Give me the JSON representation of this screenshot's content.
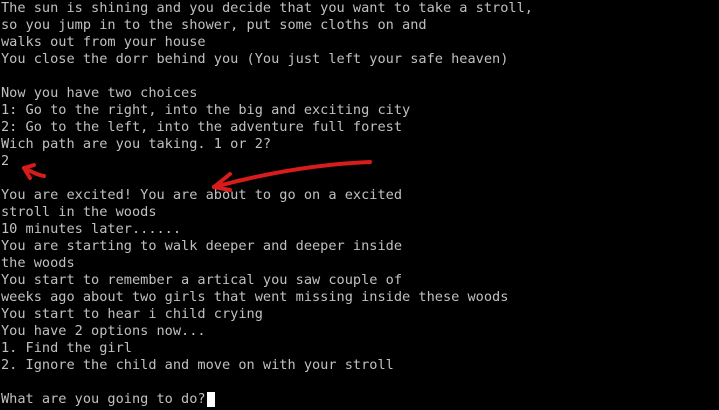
{
  "terminal": {
    "lines": [
      "The sun is shining and you decide that you want to take a stroll,",
      "so you jump in to the shower, put some cloths on and",
      "walks out from your house",
      "You close the dorr behind you (You just left your safe heaven)",
      "",
      "Now you have two choices",
      "1: Go to the right, into the big and exciting city",
      "2: Go to the left, into the adventure full forest",
      "Wich path are you taking. 1 or 2?",
      "2",
      "",
      "You are excited! You are about to go on a excited",
      "stroll in the woods",
      "10 minutes later......",
      "You are starting to walk deeper and deeper inside",
      "the woods",
      "You start to remember a artical you saw couple of",
      "weeks ago about two girls that went missing inside these woods",
      "You start to hear i child crying",
      "You have 2 options now...",
      "1. Find the girl",
      "2. Ignore the child and move on with your stroll",
      ""
    ],
    "prompt": "What are you going to do?"
  },
  "colors": {
    "background": "#000000",
    "text": "#c0c0c0",
    "cursor": "#ffffff",
    "annotation": "#d81b1b"
  },
  "annotation_icons": [
    "red-arrow-icon",
    "red-arrow-icon"
  ]
}
